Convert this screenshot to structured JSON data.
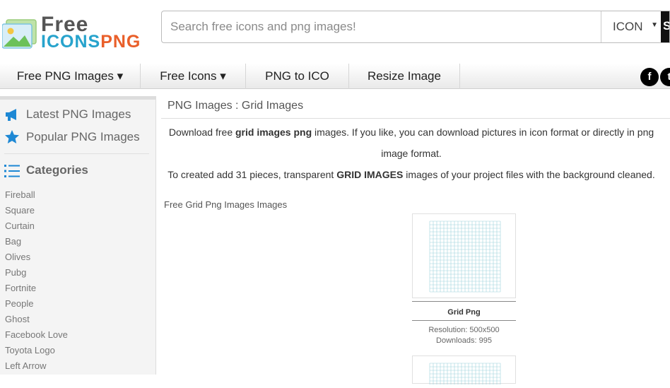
{
  "logo": {
    "line1": "Free",
    "line2_a": "ICONS",
    "line2_b": "PNG"
  },
  "search": {
    "placeholder": "Search free icons and png images!",
    "type_selected": "ICON"
  },
  "nav": {
    "items": [
      {
        "label": "Free PNG Images ▾"
      },
      {
        "label": "Free Icons ▾"
      },
      {
        "label": "PNG to ICO"
      },
      {
        "label": "Resize Image"
      }
    ],
    "social": {
      "facebook": "f",
      "twitter": "t"
    }
  },
  "sidebar": {
    "latest": "Latest PNG Images",
    "popular": "Popular PNG Images",
    "categories_title": "Categories",
    "categories": [
      "Fireball",
      "Square",
      "Curtain",
      "Bag",
      "Olives",
      "Pubg",
      "Fortnite",
      "People",
      "Ghost",
      "Facebook Love",
      "Toyota Logo",
      "Left Arrow"
    ]
  },
  "main": {
    "breadcrumb": "PNG Images : Grid Images",
    "intro1_pre": "Download free ",
    "intro1_bold": "grid images png",
    "intro1_post": " images. If you like, you can download pictures in icon format or directly in png image format.",
    "intro2_pre": "To created add 31 pieces, transparent ",
    "intro2_bold": "GRID IMAGES",
    "intro2_post": " images of your project files with the background cleaned.",
    "section_label": "Free Grid Png Images Images",
    "cards": [
      {
        "title": "Grid Png",
        "resolution": "Resolution: 500x500",
        "downloads": "Downloads: 995"
      }
    ]
  },
  "colors": {
    "accent_blue": "#27a3cc",
    "logo_orange": "#e95f2a",
    "icon_blue": "#1e88d4",
    "grid_line": "#9fd3dd"
  }
}
